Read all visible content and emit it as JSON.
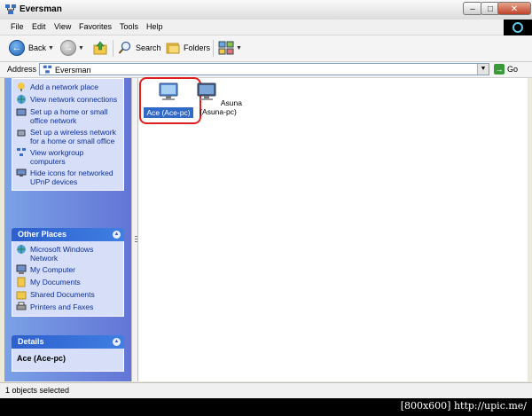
{
  "window": {
    "title": "Eversman"
  },
  "menu": [
    "File",
    "Edit",
    "View",
    "Favorites",
    "Tools",
    "Help"
  ],
  "toolbar": {
    "back_label": "Back",
    "search_label": "Search",
    "folders_label": "Folders"
  },
  "address": {
    "label": "Address",
    "value": "Eversman",
    "go_label": "Go"
  },
  "tasks": [
    "Add a network place",
    "View network connections",
    "Set up a home or small office network",
    "Set up a wireless network for a home or small office",
    "View workgroup computers",
    "Hide icons for networked UPnP devices"
  ],
  "other_places": {
    "title": "Other Places",
    "items": [
      "Microsoft Windows Network",
      "My Computer",
      "My Documents",
      "Shared Documents",
      "Printers and Faxes"
    ]
  },
  "details": {
    "title": "Details",
    "name": "Ace (Ace-pc)"
  },
  "computers": [
    {
      "label": "Ace (Ace-pc)",
      "selected": true
    },
    {
      "label": "Asuna (Asuna-pc)",
      "selected": false
    }
  ],
  "status": "1 objects selected",
  "watermark": "[800x600] http://upic.me/",
  "icons": [
    "network-icon",
    "back-arrow-icon",
    "forward-arrow-icon",
    "up-folder-icon",
    "search-icon",
    "folders-icon",
    "views-icon",
    "go-arrow-icon",
    "computer-icon"
  ]
}
